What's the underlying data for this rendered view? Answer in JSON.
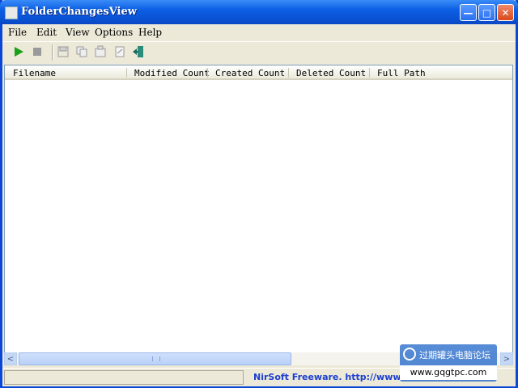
{
  "window": {
    "title": "FolderChangesView"
  },
  "titlebar": {
    "minimize_glyph": "—",
    "maximize_glyph": "□",
    "close_glyph": "✕"
  },
  "menu": [
    "File",
    "Edit",
    "View",
    "Options",
    "Help"
  ],
  "toolbar": {
    "icons": [
      "play-icon",
      "stop-icon",
      "save-icon",
      "copy-icon",
      "properties-icon",
      "html-report-icon",
      "exit-icon"
    ]
  },
  "columns": [
    "Filename",
    "Modified Count",
    "Created Count",
    "Deleted Count",
    "Full Path"
  ],
  "rows": [],
  "scrollbar": {
    "left_arrow": "<",
    "right_arrow": ">"
  },
  "status": {
    "link": "NirSoft Freeware.  http://www.nirs"
  },
  "watermark": {
    "cn": "过期罐头电脑论坛",
    "url": "www.gqgtpc.com"
  },
  "colors": {
    "title_bar": "#0a4fd0",
    "face": "#ece9d8",
    "link": "#1c3fd0"
  }
}
